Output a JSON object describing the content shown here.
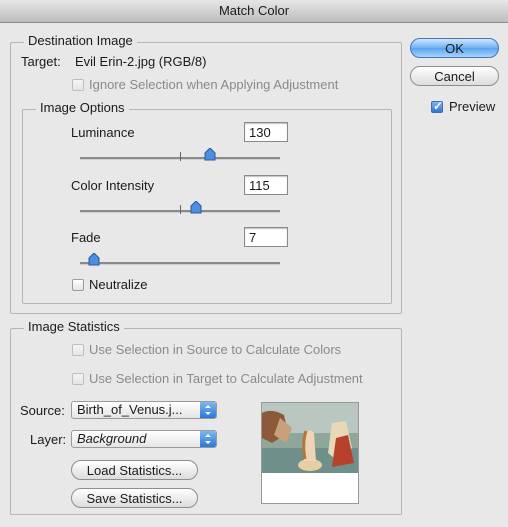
{
  "window": {
    "title": "Match Color"
  },
  "buttons": {
    "ok": "OK",
    "cancel": "Cancel"
  },
  "preview": {
    "label": "Preview",
    "checked": true
  },
  "destination": {
    "legend": "Destination Image",
    "target_label": "Target:",
    "target_value": "Evil Erin-2.jpg (RGB/8)",
    "ignore_selection_label": "Ignore Selection when Applying Adjustment"
  },
  "image_options": {
    "legend": "Image Options",
    "luminance": {
      "label": "Luminance",
      "value": "130"
    },
    "color_intensity": {
      "label": "Color Intensity",
      "value": "115"
    },
    "fade": {
      "label": "Fade",
      "value": "7"
    },
    "neutralize_label": "Neutralize"
  },
  "image_statistics": {
    "legend": "Image Statistics",
    "use_sel_source_label": "Use Selection in Source to Calculate Colors",
    "use_sel_target_label": "Use Selection in Target to Calculate Adjustment",
    "source_label": "Source:",
    "source_value": "Birth_of_Venus.j...",
    "layer_label": "Layer:",
    "layer_value": "Background",
    "load_label": "Load Statistics...",
    "save_label": "Save Statistics..."
  },
  "colors": {
    "accent": "#2a78d8",
    "dialog_bg": "#e8e8e8"
  }
}
